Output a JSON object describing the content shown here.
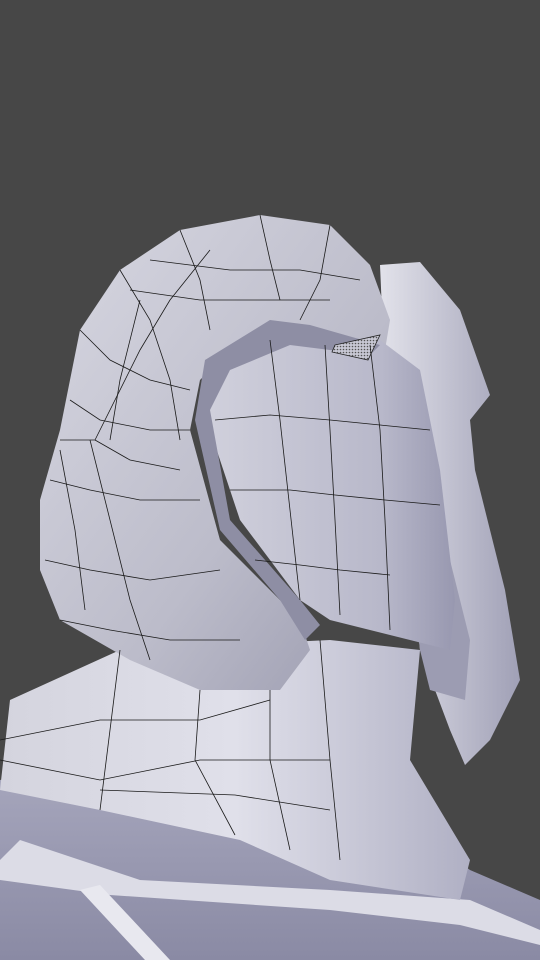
{
  "viewport": {
    "background_color": "#474747",
    "mode": "3d-viewport"
  },
  "model": {
    "name": "helmet-head-mesh",
    "surface_color": "#c4c4d0",
    "shadow_color": "#8c8ca4",
    "wireframe_color": "#1a1a1a",
    "selected_face_color": "#7f7f8a",
    "parts": [
      "helmet-shell",
      "helmet-visor",
      "visor-side-fin",
      "neck",
      "shoulders",
      "collar-plate"
    ]
  }
}
